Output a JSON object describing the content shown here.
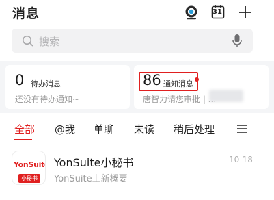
{
  "header": {
    "title": "消息",
    "icons": [
      "live-stream-icon",
      "calendar-icon",
      "plus-icon"
    ],
    "calendar_day": "31"
  },
  "search": {
    "placeholder": "搜索",
    "icons": [
      "search-icon",
      "microphone-icon"
    ]
  },
  "cards": {
    "todo": {
      "count": "0",
      "label": "待办消息",
      "desc": "还没有待办通知~"
    },
    "notice": {
      "count": "86",
      "label": "通知消息",
      "desc": "唐智力请您审批 |             ..."
    }
  },
  "tabs": {
    "items": [
      "全部",
      "@我",
      "单聊",
      "未读",
      "稍后处理"
    ],
    "active_index": 0,
    "menu_icon": "menu-icon"
  },
  "messages": [
    {
      "avatar_brand": "YonSuite",
      "avatar_badge": "小秘书",
      "title": "YonSuite小秘书",
      "subtitle": "YonSuite上新概要",
      "time": "10-18"
    }
  ],
  "colors": {
    "accent": "#e02020",
    "muted_text": "#9a9a9a",
    "search_bg": "#f2f2f3",
    "cards_bg": "#f4f5f7"
  }
}
